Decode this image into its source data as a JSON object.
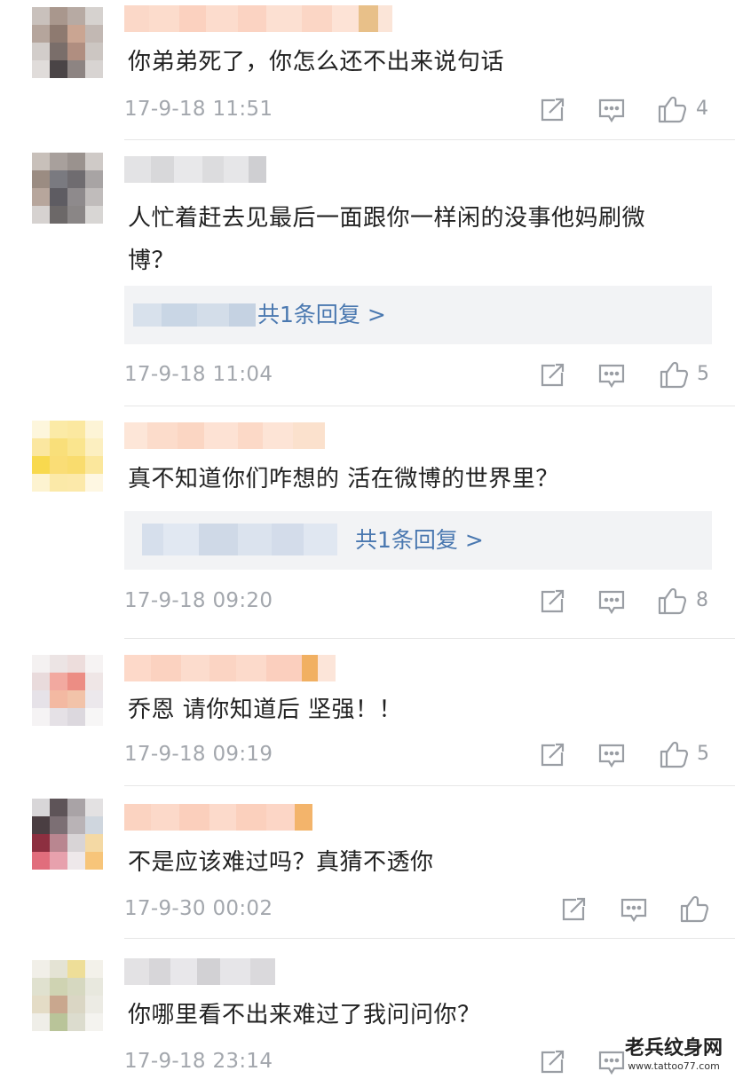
{
  "comments": [
    {
      "text": "你弟弟死了，你怎么还不出来说句话",
      "time": "17-9-18 11:51",
      "likes": "4",
      "reply": ""
    },
    {
      "text": "人忙着赶去见最后一面跟你一样闲的没事他妈刷微博？",
      "time": "17-9-18 11:04",
      "likes": "5",
      "reply": "共1条回复 >"
    },
    {
      "text": "真不知道你们咋想的 活在微博的世界里？",
      "time": "17-9-18 09:20",
      "likes": "8",
      "reply": "共1条回复 >"
    },
    {
      "text": "乔恩 请你知道后 坚强！！",
      "time": "17-9-18 09:19",
      "likes": "5",
      "reply": ""
    },
    {
      "text": "不是应该难过吗？真猜不透你",
      "time": "17-9-30 00:02",
      "likes": "",
      "reply": ""
    },
    {
      "text": "你哪里看不出来难过了我问问你？",
      "time": "17-9-18 23:14",
      "likes": "",
      "reply": ""
    }
  ],
  "icons": {
    "share": "share-icon",
    "comment": "comment-icon",
    "like": "like-icon"
  },
  "colors": {
    "reply_link": "#4a78b0",
    "timestamp": "#a3a7ad",
    "reply_bg": "#f2f3f5"
  },
  "watermark": {
    "title": "老兵纹身网",
    "url": "www.tattoo77.com"
  }
}
